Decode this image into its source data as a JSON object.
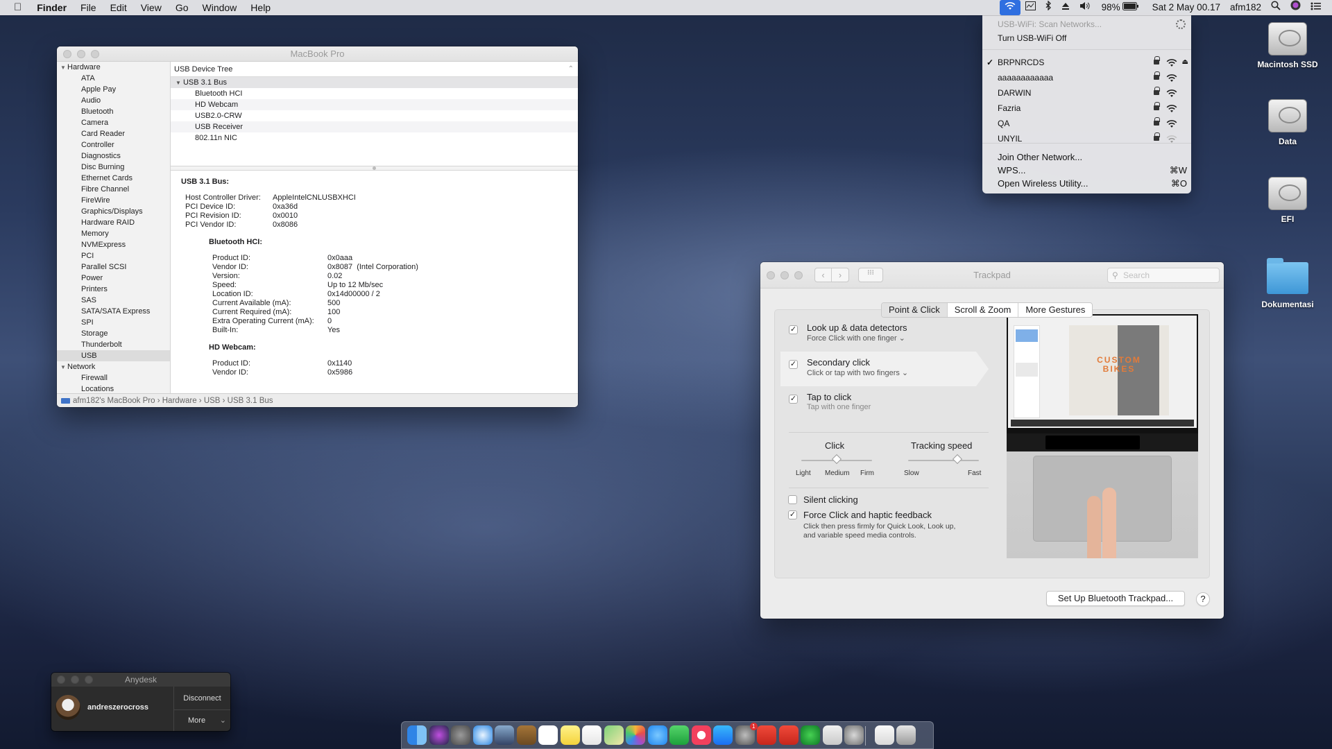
{
  "menubar": {
    "apple": "",
    "app_name": "Finder",
    "menus": [
      "File",
      "Edit",
      "View",
      "Go",
      "Window",
      "Help"
    ],
    "battery": "98%",
    "datetime": "Sat 2 May  00.17",
    "user": "afm182"
  },
  "system_info": {
    "title": "MacBook Pro",
    "sidebar": {
      "hardware_label": "Hardware",
      "hardware_items": [
        "ATA",
        "Apple Pay",
        "Audio",
        "Bluetooth",
        "Camera",
        "Card Reader",
        "Controller",
        "Diagnostics",
        "Disc Burning",
        "Ethernet Cards",
        "Fibre Channel",
        "FireWire",
        "Graphics/Displays",
        "Hardware RAID",
        "Memory",
        "NVMExpress",
        "PCI",
        "Parallel SCSI",
        "Power",
        "Printers",
        "SAS",
        "SATA/SATA Express",
        "SPI",
        "Storage",
        "Thunderbolt",
        "USB"
      ],
      "network_label": "Network",
      "network_items": [
        "Firewall",
        "Locations"
      ]
    },
    "tree_header": "USB Device Tree",
    "tree_parent": "USB 3.1 Bus",
    "tree_children": [
      "Bluetooth HCI",
      "HD Webcam",
      "USB2.0-CRW",
      "USB Receiver",
      "802.11n NIC"
    ],
    "detail": {
      "bus_title": "USB 3.1 Bus:",
      "bus_props": [
        {
          "k": "Host Controller Driver:",
          "v": "AppleIntelCNLUSBXHCI"
        },
        {
          "k": "PCI Device ID:",
          "v": "0xa36d"
        },
        {
          "k": "PCI Revision ID:",
          "v": "0x0010"
        },
        {
          "k": "PCI Vendor ID:",
          "v": "0x8086"
        }
      ],
      "dev1_title": "Bluetooth HCI:",
      "dev1_props": [
        {
          "k": "Product ID:",
          "v": "0x0aaa"
        },
        {
          "k": "Vendor ID:",
          "v": "0x8087  (Intel Corporation)"
        },
        {
          "k": "Version:",
          "v": "0.02"
        },
        {
          "k": "Speed:",
          "v": "Up to 12 Mb/sec"
        },
        {
          "k": "Location ID:",
          "v": "0x14d00000 / 2"
        },
        {
          "k": "Current Available (mA):",
          "v": "500"
        },
        {
          "k": "Current Required (mA):",
          "v": "100"
        },
        {
          "k": "Extra Operating Current (mA):",
          "v": "0"
        },
        {
          "k": "Built-In:",
          "v": "Yes"
        }
      ],
      "dev2_title": "HD Webcam:",
      "dev2_props": [
        {
          "k": "Product ID:",
          "v": "0x1140"
        },
        {
          "k": "Vendor ID:",
          "v": "0x5986"
        }
      ]
    },
    "path": "afm182's MacBook Pro  ›  Hardware  ›  USB  ›  USB 3.1 Bus"
  },
  "wifi_menu": {
    "scan": "USB-WiFi: Scan Networks...",
    "turn_off": "Turn USB-WiFi Off",
    "networks": [
      "BRPNRCDS",
      "aaaaaaaaaaaa",
      "DARWIN",
      "Fazria",
      "QA",
      "UNYIL"
    ],
    "connected_check": "✓",
    "join_other": "Join Other Network...",
    "wps": "WPS...",
    "wps_shortcut": "⌘W",
    "open_utility": "Open Wireless Utility...",
    "open_utility_shortcut": "⌘O"
  },
  "trackpad": {
    "title": "Trackpad",
    "search_placeholder": "Search",
    "tabs": [
      "Point & Click",
      "Scroll & Zoom",
      "More Gestures"
    ],
    "opt1_title": "Look up & data detectors",
    "opt1_sub": "Force Click with one finger ⌄",
    "opt2_title": "Secondary click",
    "opt2_sub": "Click or tap with two fingers ⌄",
    "opt3_title": "Tap to click",
    "opt3_sub": "Tap with one finger",
    "click_label": "Click",
    "click_ticks": [
      "Light",
      "Medium",
      "Firm"
    ],
    "click_level": "Medium",
    "tracking_label": "Tracking speed",
    "tracking_ticks": [
      "Slow",
      "Fast"
    ],
    "tracking_value": 0.7,
    "silent_label": "Silent clicking",
    "force_label": "Force Click and haptic feedback",
    "force_desc1": "Click then press firmly for Quick Look, Look up,",
    "force_desc2": "and variable speed media controls.",
    "preview_text": "CUSTOM BIKES",
    "setup_button": "Set Up Bluetooth Trackpad...",
    "help": "?"
  },
  "desktop": {
    "icons": [
      "Macintosh SSD",
      "Data",
      "EFI",
      "Dokumentasi"
    ]
  },
  "anydesk": {
    "title": "Anydesk",
    "user": "andreszerocross",
    "disconnect": "Disconnect",
    "more": "More"
  },
  "dock": {
    "badge_sysprefs": "1"
  }
}
